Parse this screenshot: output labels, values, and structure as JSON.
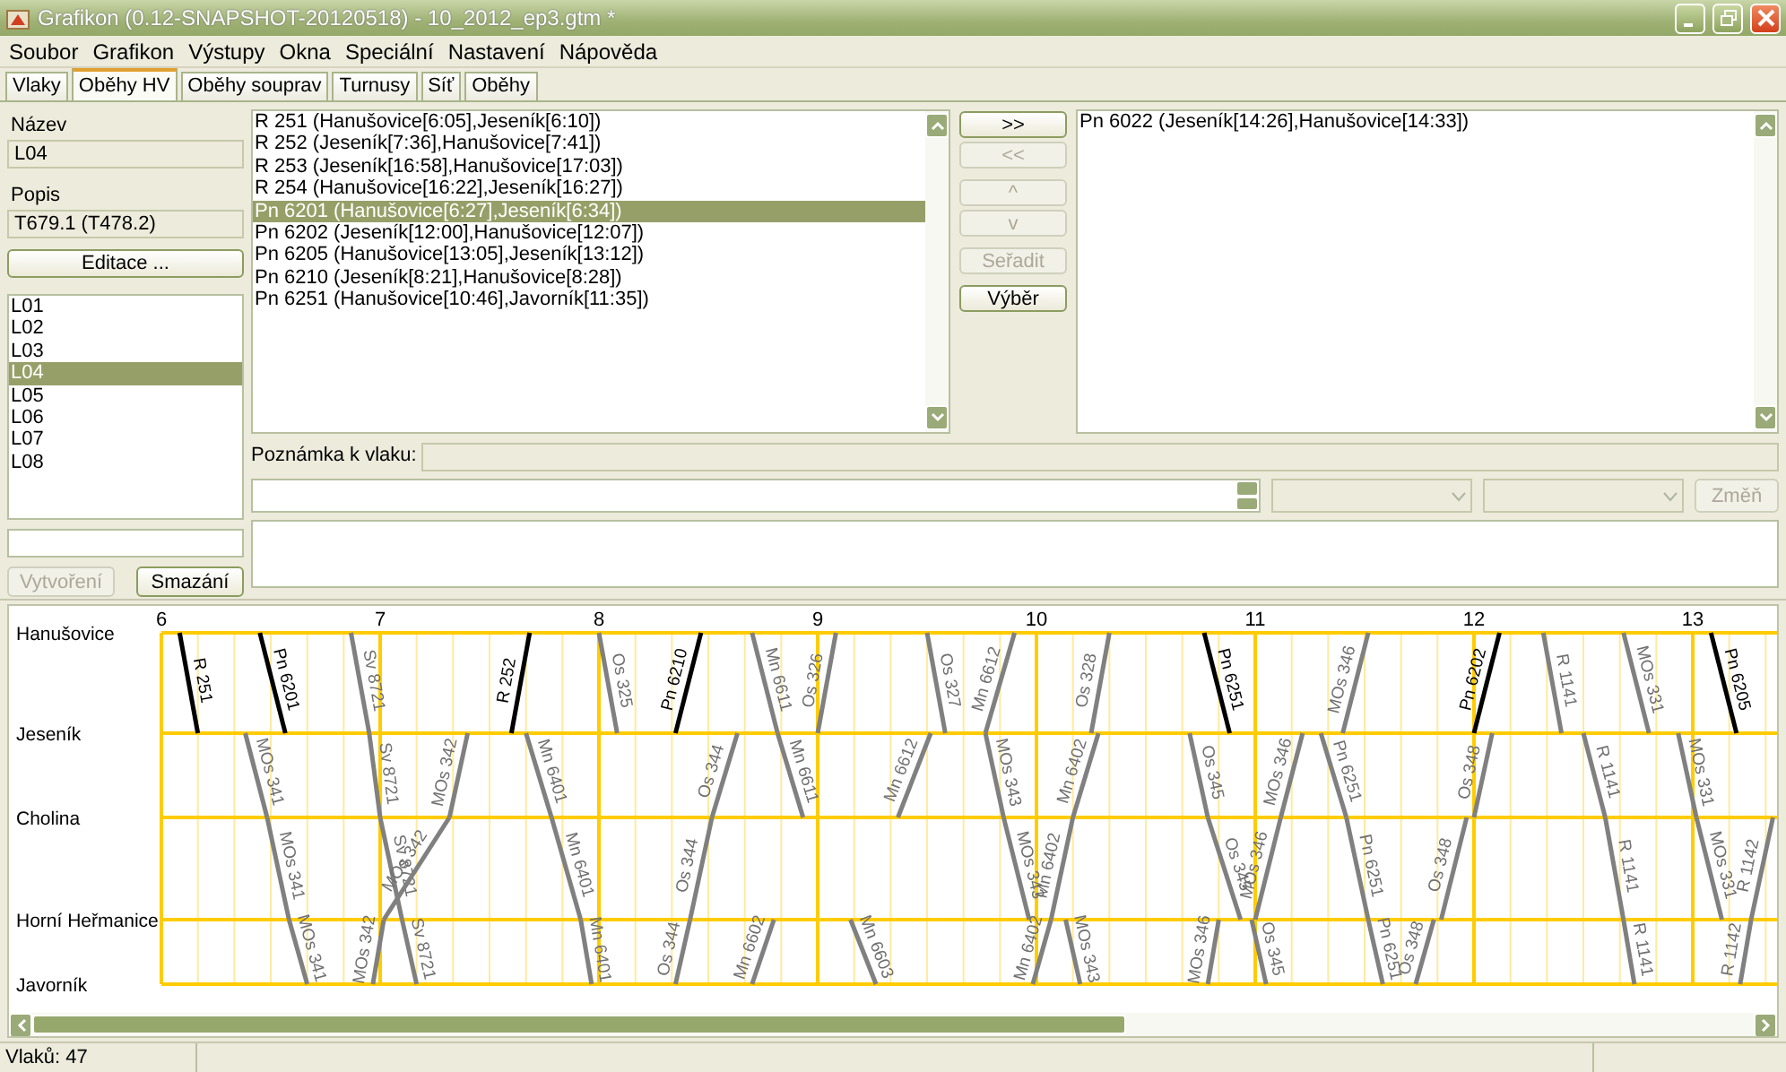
{
  "window": {
    "title": "Grafikon (0.12-SNAPSHOT-20120518) - 10_2012_ep3.gtm *"
  },
  "menu": [
    "Soubor",
    "Grafikon",
    "Výstupy",
    "Okna",
    "Speciální",
    "Nastavení",
    "Nápověda"
  ],
  "tabs": [
    {
      "label": "Vlaky",
      "selected": false
    },
    {
      "label": "Oběhy HV",
      "selected": true
    },
    {
      "label": "Oběhy souprav",
      "selected": false
    },
    {
      "label": "Turnusy",
      "selected": false
    },
    {
      "label": "Síť",
      "selected": false
    },
    {
      "label": "Oběhy",
      "selected": false
    }
  ],
  "circulation": {
    "name_label": "Název",
    "name_value": "L04",
    "description_label": "Popis",
    "description_value": "T679.1 (T478.2)",
    "edit_button": "Editace ...",
    "list": [
      {
        "label": "L01",
        "selected": false
      },
      {
        "label": "L02",
        "selected": false
      },
      {
        "label": "L03",
        "selected": false
      },
      {
        "label": "L04",
        "selected": true
      },
      {
        "label": "L05",
        "selected": false
      },
      {
        "label": "L06",
        "selected": false
      },
      {
        "label": "L07",
        "selected": false
      },
      {
        "label": "L08",
        "selected": false
      }
    ],
    "create_button": {
      "label": "Vytvoření",
      "disabled": true
    },
    "delete_button": {
      "label": "Smazání",
      "disabled": false
    }
  },
  "available_trains": [
    {
      "label": "R 251 (Hanušovice[6:05],Jeseník[6:10])",
      "selected": false
    },
    {
      "label": "R 252 (Jeseník[7:36],Hanušovice[7:41])",
      "selected": false
    },
    {
      "label": "R 253 (Jeseník[16:58],Hanušovice[17:03])",
      "selected": false
    },
    {
      "label": "R 254 (Hanušovice[16:22],Jeseník[16:27])",
      "selected": false
    },
    {
      "label": "Pn 6201 (Hanušovice[6:27],Jeseník[6:34])",
      "selected": true
    },
    {
      "label": "Pn 6202 (Jeseník[12:00],Hanušovice[12:07])",
      "selected": false
    },
    {
      "label": "Pn 6205 (Hanušovice[13:05],Jeseník[13:12])",
      "selected": false
    },
    {
      "label": "Pn 6210 (Jeseník[8:21],Hanušovice[8:28])",
      "selected": false
    },
    {
      "label": "Pn 6251 (Hanušovice[10:46],Javorník[11:35])",
      "selected": false
    }
  ],
  "transfer_buttons": [
    {
      "label": ">>",
      "disabled": false
    },
    {
      "label": "<<",
      "disabled": true
    },
    {
      "label": "^",
      "disabled": true
    },
    {
      "label": "v",
      "disabled": true
    },
    {
      "label": "Seřadit",
      "disabled": true
    },
    {
      "label": "Výběr",
      "disabled": false
    }
  ],
  "assigned_trains": [
    {
      "label": "Pn 6022 (Jeseník[14:26],Hanušovice[14:33])",
      "selected": false
    }
  ],
  "train_note": {
    "label": "Poznámka k vlaku:"
  },
  "change_button": {
    "label": "Změň",
    "disabled": true
  },
  "graph": {
    "stations": [
      "Hanušovice",
      "Jeseník",
      "Cholina",
      "Horní Heřmanice",
      "Javorník"
    ],
    "hours": [
      "6",
      "7",
      "8",
      "9",
      "10",
      "11",
      "12",
      "13"
    ],
    "segments": [
      {
        "label": "R 251",
        "selected": true
      },
      {
        "label": "Pn 6201",
        "selected": true
      },
      {
        "label": "Sv 8721",
        "selected": false
      },
      {
        "label": "Sv 8721",
        "selected": false
      },
      {
        "label": "Sv 8721",
        "selected": false
      },
      {
        "label": "Sv 8721",
        "selected": false
      },
      {
        "label": "MOs 341",
        "selected": false
      },
      {
        "label": "MOs 341",
        "selected": false
      },
      {
        "label": "MOs 341",
        "selected": false
      },
      {
        "label": "MOs 342",
        "selected": false
      },
      {
        "label": "MOs 342",
        "selected": false
      },
      {
        "label": "MOs 342",
        "selected": false
      },
      {
        "label": "R 252",
        "selected": true
      },
      {
        "label": "Mn 6401",
        "selected": false
      },
      {
        "label": "Mn 6401",
        "selected": false
      },
      {
        "label": "Mn 6401",
        "selected": false
      },
      {
        "label": "Os 325",
        "selected": false
      },
      {
        "label": "Pn 6210",
        "selected": true
      },
      {
        "label": "Os 344",
        "selected": false
      },
      {
        "label": "Os 344",
        "selected": false
      },
      {
        "label": "Os 344",
        "selected": false
      },
      {
        "label": "Mn 6611",
        "selected": false
      },
      {
        "label": "Mn 6611",
        "selected": false
      },
      {
        "label": "Os 326",
        "selected": false
      },
      {
        "label": "Mn 6602",
        "selected": false
      },
      {
        "label": "Mn 6603",
        "selected": false
      },
      {
        "label": "Mn 6612",
        "selected": false
      },
      {
        "label": "Mn 6612",
        "selected": false
      },
      {
        "label": "Os 327",
        "selected": false
      },
      {
        "label": "MOs 343",
        "selected": false
      },
      {
        "label": "MOs 343",
        "selected": false
      },
      {
        "label": "MOs 343",
        "selected": false
      },
      {
        "label": "Mn 6402",
        "selected": false
      },
      {
        "label": "Mn 6402",
        "selected": false
      },
      {
        "label": "Mn 6402",
        "selected": false
      },
      {
        "label": "Os 328",
        "selected": false
      },
      {
        "label": "Pn 6251",
        "selected": true
      },
      {
        "label": "Pn 6251",
        "selected": false
      },
      {
        "label": "Pn 6251",
        "selected": false
      },
      {
        "label": "Pn 6251",
        "selected": false
      },
      {
        "label": "Os 345",
        "selected": false
      },
      {
        "label": "Os 345",
        "selected": false
      },
      {
        "label": "Os 345",
        "selected": false
      },
      {
        "label": "MOs 346",
        "selected": false
      },
      {
        "label": "MOs 346",
        "selected": false
      },
      {
        "label": "MOs 346",
        "selected": false
      },
      {
        "label": "MOs 346",
        "selected": false
      },
      {
        "label": "Pn 6202",
        "selected": true
      },
      {
        "label": "Os 348",
        "selected": false
      },
      {
        "label": "Os 348",
        "selected": false
      },
      {
        "label": "Os 348",
        "selected": false
      },
      {
        "label": "R 1141",
        "selected": false
      },
      {
        "label": "R 1141",
        "selected": false
      },
      {
        "label": "R 1141",
        "selected": false
      },
      {
        "label": "R 1141",
        "selected": false
      },
      {
        "label": "MOs 331",
        "selected": false
      },
      {
        "label": "MOs 331",
        "selected": false
      },
      {
        "label": "MOs 331",
        "selected": false
      },
      {
        "label": "Pn 6205",
        "selected": true
      },
      {
        "label": "R 1142",
        "selected": false
      },
      {
        "label": "R 1142",
        "selected": false
      }
    ]
  },
  "status_bar": [
    "Vlaků: 47"
  ]
}
